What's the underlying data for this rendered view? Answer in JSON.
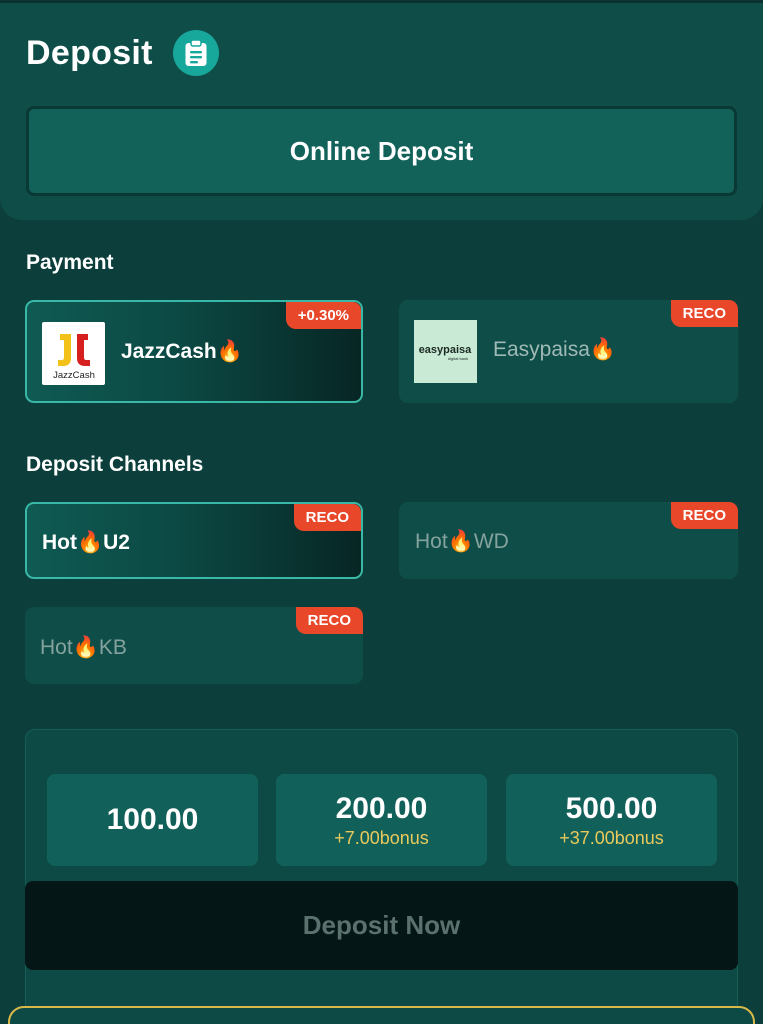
{
  "header": {
    "title": "Deposit",
    "icon": "clipboard-icon"
  },
  "online_deposit_label": "Online Deposit",
  "payment": {
    "label": "Payment",
    "methods": [
      {
        "name": "JazzCash🔥",
        "badge": "+0.30%",
        "logo_text": "JazzCash",
        "selected": true
      },
      {
        "name": "Easypaisa🔥",
        "badge": "RECO",
        "logo_text": "easypaisa",
        "logo_subtext": "digital bank",
        "selected": false
      }
    ]
  },
  "channels": {
    "label": "Deposit Channels",
    "items": [
      {
        "name": "Hot🔥U2",
        "badge": "RECO",
        "selected": true
      },
      {
        "name": "Hot🔥WD",
        "badge": "RECO",
        "selected": false
      },
      {
        "name": "Hot🔥KB",
        "badge": "RECO",
        "selected": false
      }
    ]
  },
  "amounts": [
    {
      "value": "100.00",
      "bonus": ""
    },
    {
      "value": "200.00",
      "bonus": "+7.00bonus"
    },
    {
      "value": "500.00",
      "bonus": "+37.00bonus"
    }
  ],
  "deposit_now_label": "Deposit Now",
  "colors": {
    "background": "#0c3f3b",
    "card": "#0f4e48",
    "accent": "#17a89b",
    "badge": "#e8472a",
    "bonus": "#e9c95a",
    "selected_border": "#39b8a8"
  }
}
